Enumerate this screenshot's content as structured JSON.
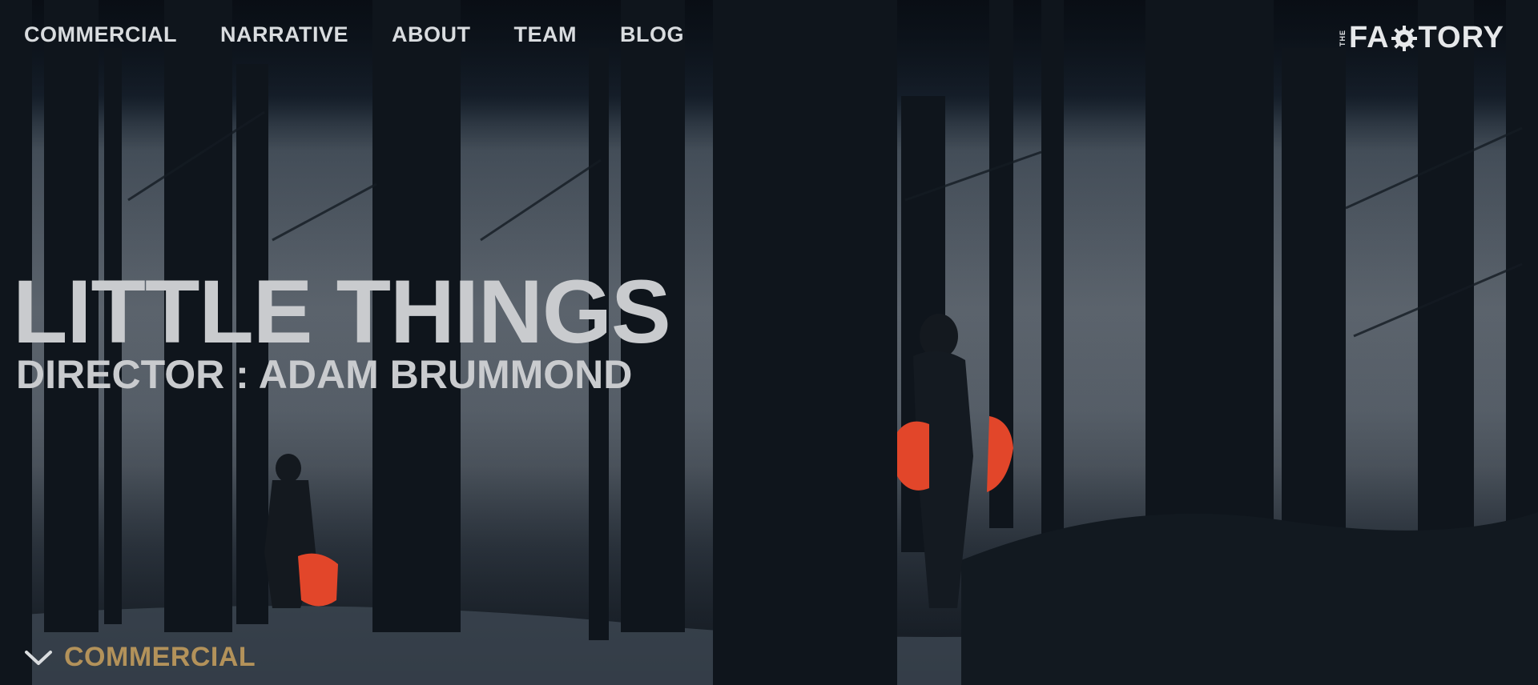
{
  "nav": {
    "items": [
      "COMMERCIAL",
      "NARRATIVE",
      "ABOUT",
      "TEAM",
      "BLOG"
    ]
  },
  "logo": {
    "small": "THE",
    "pre": "FA",
    "post": "TORY"
  },
  "hero": {
    "title": "LITTLE THINGS",
    "subtitle": "DIRECTOR : ADAM BRUMMOND"
  },
  "category": {
    "label": "COMMERCIAL",
    "icon": "chevron-down-icon"
  },
  "colors": {
    "nav_text": "#d9dcdf",
    "title_text": "#c9cbce",
    "category_accent": "#b3925a",
    "jacket_orange": "#e2462a"
  }
}
